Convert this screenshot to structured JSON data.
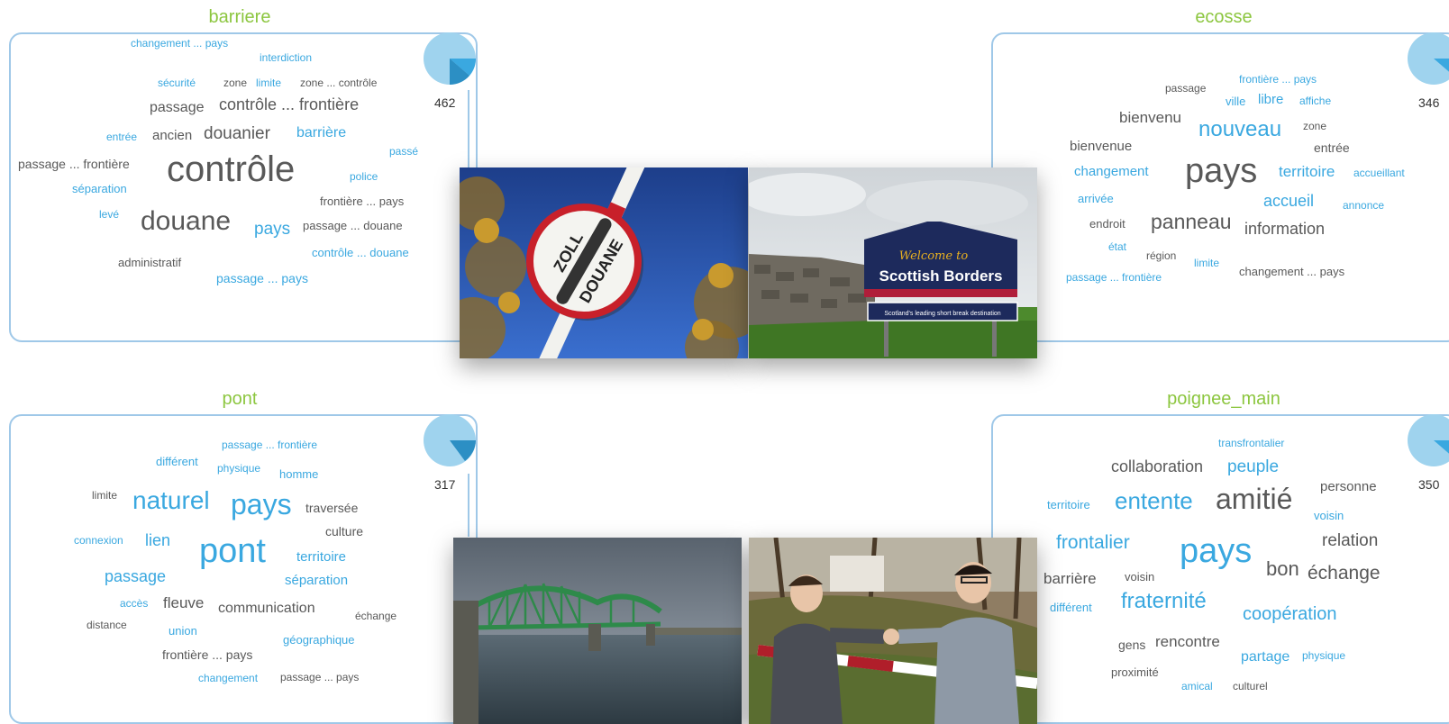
{
  "panels": [
    {
      "title": "barriere",
      "count": "462",
      "words": [
        {
          "t": "changement ... pays",
          "c": "blue",
          "s": 12
        },
        {
          "t": "interdiction",
          "c": "blue",
          "s": 12
        },
        {
          "t": "sécurité",
          "c": "blue",
          "s": 12
        },
        {
          "t": "zone",
          "c": "dark",
          "s": 12
        },
        {
          "t": "limite",
          "c": "blue",
          "s": 12
        },
        {
          "t": "zone ... contrôle",
          "c": "dark",
          "s": 12
        },
        {
          "t": "passage",
          "c": "dark",
          "s": 16
        },
        {
          "t": "contrôle ... frontière",
          "c": "dark",
          "s": 18
        },
        {
          "t": "entrée",
          "c": "blue",
          "s": 12
        },
        {
          "t": "ancien",
          "c": "dark",
          "s": 15
        },
        {
          "t": "douanier",
          "c": "dark",
          "s": 19
        },
        {
          "t": "barrière",
          "c": "blue",
          "s": 16
        },
        {
          "t": "passé",
          "c": "blue",
          "s": 12
        },
        {
          "t": "passage ... frontière",
          "c": "dark",
          "s": 14
        },
        {
          "t": "séparation",
          "c": "blue",
          "s": 13
        },
        {
          "t": "contrôle",
          "c": "dark",
          "s": 40
        },
        {
          "t": "police",
          "c": "blue",
          "s": 12
        },
        {
          "t": "frontière ... pays",
          "c": "dark",
          "s": 13
        },
        {
          "t": "levé",
          "c": "blue",
          "s": 12
        },
        {
          "t": "douane",
          "c": "dark",
          "s": 30
        },
        {
          "t": "pays",
          "c": "blue",
          "s": 19
        },
        {
          "t": "passage ... douane",
          "c": "dark",
          "s": 13
        },
        {
          "t": "contrôle ... douane",
          "c": "blue",
          "s": 13
        },
        {
          "t": "administratif",
          "c": "dark",
          "s": 13
        },
        {
          "t": "passage ... pays",
          "c": "blue",
          "s": 14
        }
      ]
    },
    {
      "title": "ecosse",
      "count": "346",
      "words": [
        {
          "t": "frontière ... pays",
          "c": "blue",
          "s": 12
        },
        {
          "t": "passage",
          "c": "dark",
          "s": 12
        },
        {
          "t": "ville",
          "c": "blue",
          "s": 13
        },
        {
          "t": "libre",
          "c": "blue",
          "s": 15
        },
        {
          "t": "affiche",
          "c": "blue",
          "s": 12
        },
        {
          "t": "bienvenu",
          "c": "dark",
          "s": 17
        },
        {
          "t": "zone",
          "c": "dark",
          "s": 12
        },
        {
          "t": "nouveau",
          "c": "blue",
          "s": 24
        },
        {
          "t": "bienvenue",
          "c": "dark",
          "s": 15
        },
        {
          "t": "entrée",
          "c": "dark",
          "s": 14
        },
        {
          "t": "changement",
          "c": "blue",
          "s": 15
        },
        {
          "t": "pays",
          "c": "dark",
          "s": 38
        },
        {
          "t": "territoire",
          "c": "blue",
          "s": 17
        },
        {
          "t": "accueillant",
          "c": "blue",
          "s": 12
        },
        {
          "t": "arrivée",
          "c": "blue",
          "s": 13
        },
        {
          "t": "accueil",
          "c": "blue",
          "s": 18
        },
        {
          "t": "annonce",
          "c": "blue",
          "s": 12
        },
        {
          "t": "endroit",
          "c": "dark",
          "s": 13
        },
        {
          "t": "panneau",
          "c": "dark",
          "s": 23
        },
        {
          "t": "information",
          "c": "dark",
          "s": 18
        },
        {
          "t": "état",
          "c": "blue",
          "s": 12
        },
        {
          "t": "région",
          "c": "dark",
          "s": 12
        },
        {
          "t": "limite",
          "c": "blue",
          "s": 12
        },
        {
          "t": "changement ... pays",
          "c": "dark",
          "s": 13
        },
        {
          "t": "passage ... frontière",
          "c": "blue",
          "s": 12
        }
      ]
    },
    {
      "title": "pont",
      "count": "317",
      "words": [
        {
          "t": "passage ... frontière",
          "c": "blue",
          "s": 12
        },
        {
          "t": "différent",
          "c": "blue",
          "s": 13
        },
        {
          "t": "physique",
          "c": "blue",
          "s": 12
        },
        {
          "t": "homme",
          "c": "blue",
          "s": 13
        },
        {
          "t": "limite",
          "c": "dark",
          "s": 12
        },
        {
          "t": "naturel",
          "c": "blue",
          "s": 28
        },
        {
          "t": "pays",
          "c": "blue",
          "s": 32
        },
        {
          "t": "traversée",
          "c": "dark",
          "s": 14
        },
        {
          "t": "culture",
          "c": "dark",
          "s": 14
        },
        {
          "t": "connexion",
          "c": "blue",
          "s": 12
        },
        {
          "t": "lien",
          "c": "blue",
          "s": 18
        },
        {
          "t": "pont",
          "c": "blue",
          "s": 38
        },
        {
          "t": "territoire",
          "c": "blue",
          "s": 15
        },
        {
          "t": "passage",
          "c": "blue",
          "s": 18
        },
        {
          "t": "séparation",
          "c": "blue",
          "s": 15
        },
        {
          "t": "accès",
          "c": "blue",
          "s": 12
        },
        {
          "t": "fleuve",
          "c": "dark",
          "s": 17
        },
        {
          "t": "communication",
          "c": "dark",
          "s": 16
        },
        {
          "t": "échange",
          "c": "dark",
          "s": 12
        },
        {
          "t": "distance",
          "c": "dark",
          "s": 12
        },
        {
          "t": "union",
          "c": "blue",
          "s": 13
        },
        {
          "t": "géographique",
          "c": "blue",
          "s": 13
        },
        {
          "t": "frontière ... pays",
          "c": "dark",
          "s": 14
        },
        {
          "t": "changement",
          "c": "blue",
          "s": 12
        },
        {
          "t": "passage ... pays",
          "c": "dark",
          "s": 12
        }
      ]
    },
    {
      "title": "poignee_main",
      "count": "350",
      "words": [
        {
          "t": "transfrontalier",
          "c": "blue",
          "s": 12
        },
        {
          "t": "collaboration",
          "c": "dark",
          "s": 18
        },
        {
          "t": "peuple",
          "c": "blue",
          "s": 19
        },
        {
          "t": "personne",
          "c": "dark",
          "s": 15
        },
        {
          "t": "territoire",
          "c": "blue",
          "s": 13
        },
        {
          "t": "entente",
          "c": "blue",
          "s": 26
        },
        {
          "t": "amitié",
          "c": "dark",
          "s": 32
        },
        {
          "t": "voisin",
          "c": "blue",
          "s": 13
        },
        {
          "t": "frontalier",
          "c": "blue",
          "s": 21
        },
        {
          "t": "relation",
          "c": "dark",
          "s": 19
        },
        {
          "t": "barrière",
          "c": "dark",
          "s": 17
        },
        {
          "t": "voisin",
          "c": "dark",
          "s": 13
        },
        {
          "t": "pays",
          "c": "blue",
          "s": 38
        },
        {
          "t": "bon",
          "c": "dark",
          "s": 22
        },
        {
          "t": "échange",
          "c": "dark",
          "s": 21
        },
        {
          "t": "différent",
          "c": "blue",
          "s": 13
        },
        {
          "t": "fraternité",
          "c": "blue",
          "s": 24
        },
        {
          "t": "coopération",
          "c": "blue",
          "s": 20
        },
        {
          "t": "gens",
          "c": "dark",
          "s": 14
        },
        {
          "t": "rencontre",
          "c": "dark",
          "s": 17
        },
        {
          "t": "partage",
          "c": "blue",
          "s": 16
        },
        {
          "t": "physique",
          "c": "blue",
          "s": 12
        },
        {
          "t": "proximité",
          "c": "dark",
          "s": 13
        },
        {
          "t": "amical",
          "c": "blue",
          "s": 12
        },
        {
          "t": "culturel",
          "c": "dark",
          "s": 12
        }
      ]
    }
  ],
  "photos": {
    "zoll_sign_top": "ZOLL",
    "zoll_sign_bottom": "DOUANE",
    "scotland_welcome": "Welcome to",
    "scotland_name": "Scottish Borders",
    "scotland_tagline": "Scotland's leading short break destination"
  },
  "colors": {
    "title": "#8cc63f",
    "box_border": "#9fc8e8",
    "word_blue": "#3aa8e0",
    "word_dark": "#595959",
    "pie_fill": "#3aa8e0",
    "pie_light": "#9fd3ee"
  }
}
